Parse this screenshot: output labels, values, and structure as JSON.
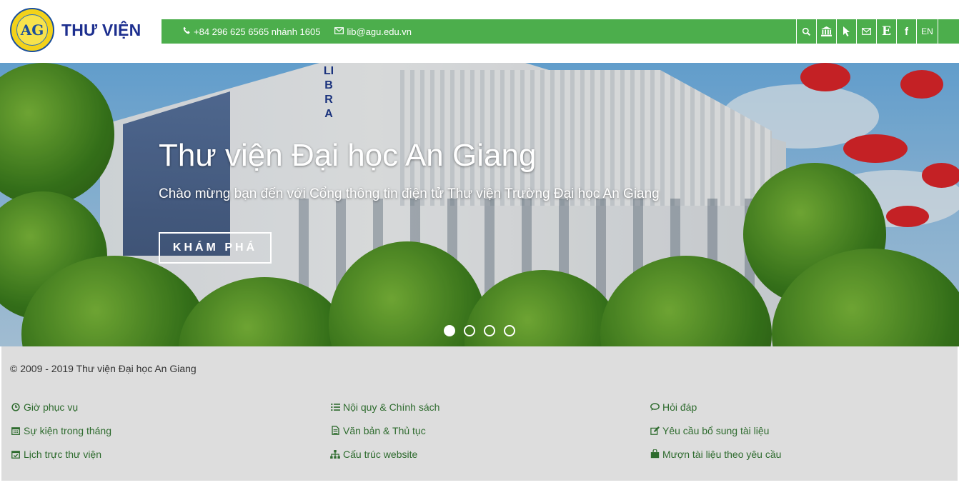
{
  "header": {
    "logo_text": "THƯ VIỆN",
    "logo_mark": "AG",
    "phone": "+84 296 625 6565 nhánh 1605",
    "email": "lib@agu.edu.vn",
    "accent_color": "#4cae4c",
    "tools": [
      {
        "icon": "search-icon"
      },
      {
        "icon": "bank-icon"
      },
      {
        "icon": "cursor-icon"
      },
      {
        "icon": "mail-icon"
      },
      {
        "icon": "e-icon",
        "label": "E"
      },
      {
        "icon": "facebook-icon",
        "label": "f"
      },
      {
        "icon": "language",
        "label": "EN"
      }
    ]
  },
  "hero": {
    "sign_text": "LIBRA",
    "title": "Thư viện Đại học An Giang",
    "subtitle": "Chào mừng bạn đến với Cổng thông tin điện tử Thư viện Trường Đại học An Giang",
    "button": "KHÁM PHÁ",
    "slides": 4,
    "active_slide": 1
  },
  "footer": {
    "copyright": "© 2009 - 2019 Thư viện Đại học An Giang",
    "links": [
      {
        "label": "Giờ phục vụ",
        "icon": "clock-icon"
      },
      {
        "label": "Nội quy & Chính sách",
        "icon": "list-icon"
      },
      {
        "label": "Hỏi đáp",
        "icon": "comment-icon"
      },
      {
        "label": "Sự kiện trong tháng",
        "icon": "calendar-icon"
      },
      {
        "label": "Văn bản & Thủ tục",
        "icon": "document-icon"
      },
      {
        "label": "Yêu cầu bổ sung tài liệu",
        "icon": "edit-icon"
      },
      {
        "label": "Lịch trực thư viện",
        "icon": "calendar-check-icon"
      },
      {
        "label": "Cấu trúc website",
        "icon": "sitemap-icon"
      },
      {
        "label": "Mượn tài liệu theo yêu cầu",
        "icon": "shopping-bag-icon"
      }
    ]
  }
}
